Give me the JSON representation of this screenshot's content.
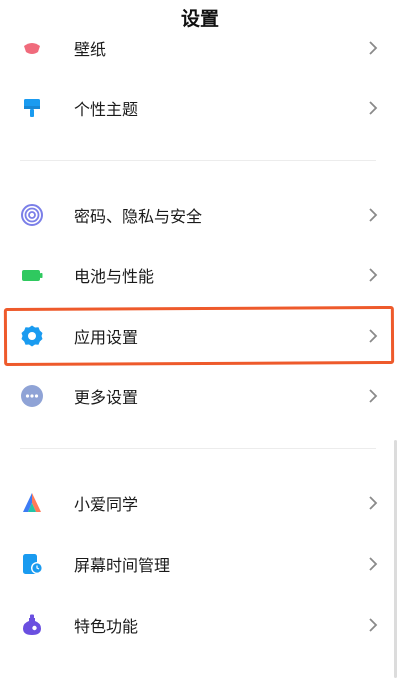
{
  "header": {
    "title": "设置"
  },
  "items": [
    {
      "label": "壁纸",
      "icon": "wallpaper-icon"
    },
    {
      "label": "个性主题",
      "icon": "theme-brush-icon"
    },
    {
      "label": "密码、隐私与安全",
      "icon": "fingerprint-icon"
    },
    {
      "label": "电池与性能",
      "icon": "battery-icon"
    },
    {
      "label": "应用设置",
      "icon": "gear-icon"
    },
    {
      "label": "更多设置",
      "icon": "more-dots-icon"
    },
    {
      "label": "小爱同学",
      "icon": "xiaoai-icon"
    },
    {
      "label": "屏幕时间管理",
      "icon": "screen-time-icon"
    },
    {
      "label": "特色功能",
      "icon": "special-features-icon"
    }
  ],
  "colors": {
    "highlight": "#ee5a2b",
    "accent_blue": "#1a9bf0",
    "battery_green": "#2fc95f",
    "more_gray": "#8fa3d6",
    "wallpaper_pink": "#f06b7c",
    "feature_purple": "#6a4fe0"
  }
}
